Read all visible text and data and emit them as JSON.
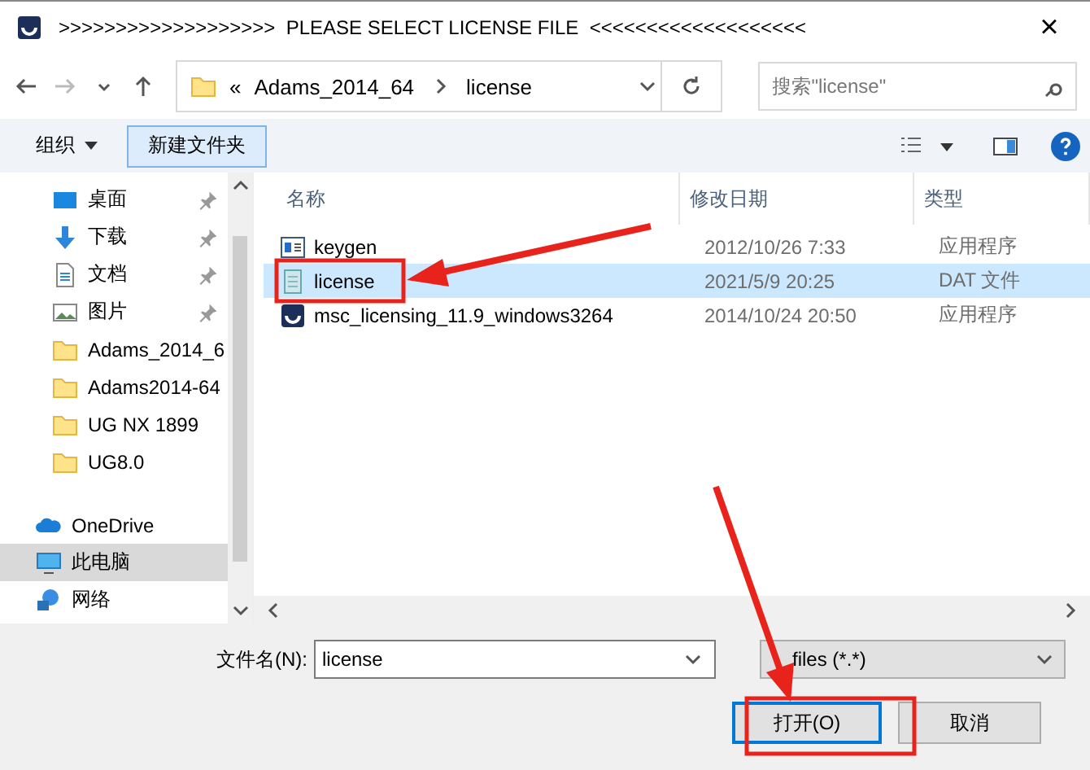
{
  "window": {
    "title": ">>>>>>>>>>>>>>>>>>>  PLEASE SELECT LICENSE FILE  <<<<<<<<<<<<<<<<<<<",
    "close": "×"
  },
  "address": {
    "overflow": "«",
    "path": [
      {
        "label": "Adams_2014_64"
      },
      {
        "label": "license"
      }
    ]
  },
  "search": {
    "placeholder": "搜索\"license\""
  },
  "toolbar": {
    "organize": "组织",
    "new_folder": "新建文件夹"
  },
  "sidebar": {
    "items": [
      {
        "label": "桌面",
        "kind": "desktop",
        "pinned": true,
        "selected": false
      },
      {
        "label": "下载",
        "kind": "download",
        "pinned": true,
        "selected": false
      },
      {
        "label": "文档",
        "kind": "document",
        "pinned": true,
        "selected": false
      },
      {
        "label": "图片",
        "kind": "pictures",
        "pinned": true,
        "selected": false
      },
      {
        "label": "Adams_2014_6",
        "kind": "folder",
        "pinned": false,
        "selected": false
      },
      {
        "label": "Adams2014-64",
        "kind": "folder",
        "pinned": false,
        "selected": false
      },
      {
        "label": "UG NX 1899",
        "kind": "folder",
        "pinned": false,
        "selected": false
      },
      {
        "label": "UG8.0",
        "kind": "folder",
        "pinned": false,
        "selected": false
      }
    ],
    "locations": [
      {
        "label": "OneDrive",
        "kind": "cloud",
        "selected": false
      },
      {
        "label": "此电脑",
        "kind": "computer",
        "selected": true
      },
      {
        "label": "网络",
        "kind": "network",
        "selected": false
      }
    ]
  },
  "table": {
    "columns": [
      "名称",
      "修改日期",
      "类型"
    ],
    "rows": [
      {
        "name": "keygen",
        "kind": "app",
        "date": "2012/10/26 7:33",
        "type": "应用程序",
        "selected": false
      },
      {
        "name": "license",
        "kind": "text",
        "date": "2021/5/9 20:25",
        "type": "DAT 文件",
        "selected": true
      },
      {
        "name": "msc_licensing_11.9_windows3264",
        "kind": "msc",
        "date": "2014/10/24 20:50",
        "type": "应用程序",
        "selected": false
      }
    ]
  },
  "footer": {
    "filename_label": "文件名(N):",
    "filename": "license",
    "filter": "files (*.*)",
    "open": "打开(O)",
    "cancel": "取消"
  }
}
